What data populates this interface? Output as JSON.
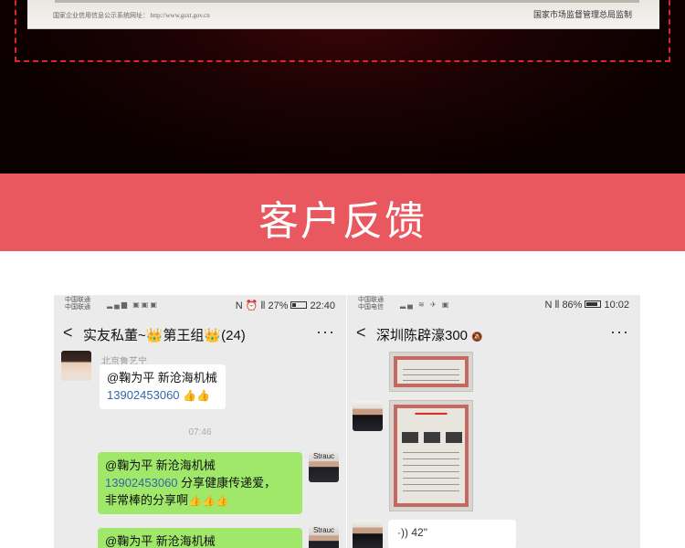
{
  "certificate": {
    "left_note": "国家企业信用信息公示系统网址：  http://www.gsxt.gov.cn",
    "right_note": "国家市场监督管理总局监制"
  },
  "section": {
    "title": "客户反馈"
  },
  "phone1": {
    "carrier_line1": "中国联通",
    "carrier_line2": "中国联通",
    "status_right": "N ⏰ ⦀ 27%",
    "time": "22:40",
    "battery_pct": 0.27,
    "chat_title": "实友私董~👑第王组👑(24)",
    "sender": "北京鲁艺宁",
    "msg1_line1": "@鞠为平 新沧海机械",
    "msg1_phone": "13902453060",
    "msg1_thumbs": "👍👍",
    "timestamp": "07:46",
    "msg2_line1": "@鞠为平 新沧海机械",
    "msg2_phone": "13902453060",
    "msg2_text": " 分享健康传递爱，",
    "msg2_line3": "非常棒的分享啊",
    "msg2_thumbs": "👍👍👍",
    "msg3_line1": "@鞠为平 新沧海机械",
    "avatar_tag": "Strauc"
  },
  "phone2": {
    "carrier_line1": "中国联通",
    "carrier_line2": "中国电信",
    "status_right": "N ⦀ 86%",
    "time": "10:02",
    "battery_pct": 0.86,
    "chat_title": "深圳陈辟濠300",
    "voice_duration": "42\""
  },
  "icons": {
    "back": "chevron-left-icon",
    "more": "more-dots-icon",
    "mute": "bell-mute-icon"
  }
}
